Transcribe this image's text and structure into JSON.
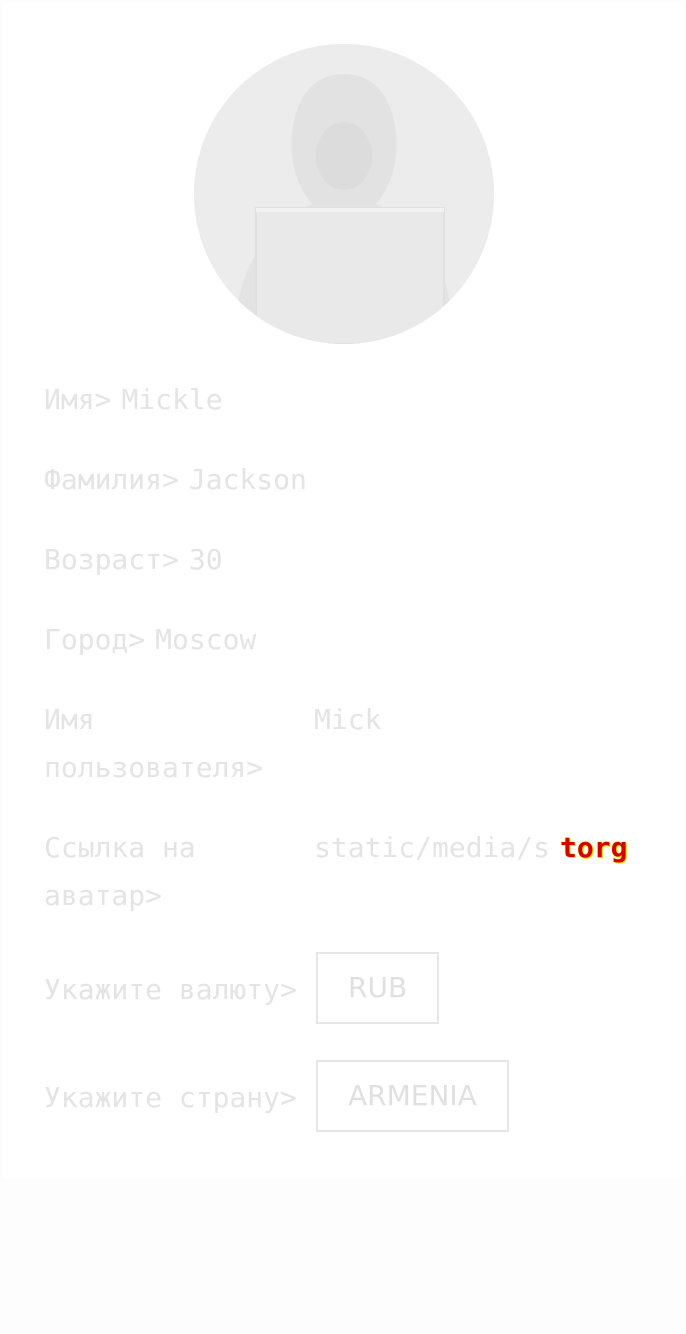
{
  "profile": {
    "avatar_icon": "hooded-hacker-with-laptop",
    "first_name": {
      "label": "Имя>",
      "value": "Mickle"
    },
    "last_name": {
      "label": "Фамилия>",
      "value": "Jackson"
    },
    "age": {
      "label": "Возраст>",
      "value": "30"
    },
    "city": {
      "label": "Город>",
      "value": "Moscow"
    },
    "username": {
      "label": "Имя пользователя>",
      "value": "Mick"
    },
    "avatar_link": {
      "label": "Ссылка на аватар>",
      "value": "static/media/s",
      "tail": "torg"
    },
    "currency": {
      "label": "Укажите валюту>",
      "value": "RUB"
    },
    "country": {
      "label": "Укажите страну>",
      "value": "ARMENIA"
    }
  },
  "colors": {
    "background": "#fdfdfd",
    "text_faded": "#e4e4e4",
    "border": "#e6e6e6",
    "highlight_red": "#d00000",
    "highlight_yellow": "#ffee00"
  }
}
